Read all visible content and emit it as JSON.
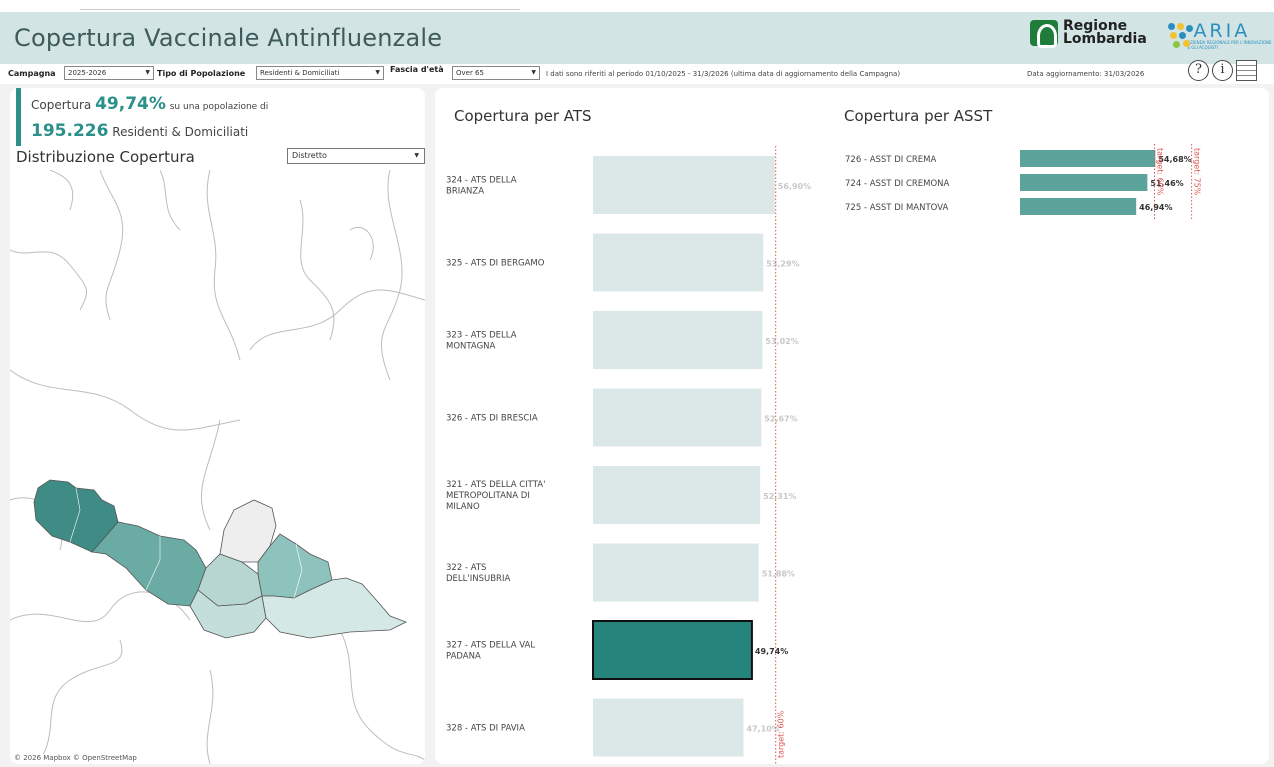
{
  "header": {
    "title": "Copertura Vaccinale Antinfluenzale",
    "logo_rl_line1": "Regione",
    "logo_rl_line2": "Lombardia",
    "logo_aria_name": "ARIA",
    "logo_aria_sub": "AZIENDA REGIONALE PER L'INNOVAZIONE E GLI ACQUISTI"
  },
  "filters": {
    "campagna_label": "Campagna",
    "campagna_value": "2025-2026",
    "popolazione_label": "Tipo di Popolazione",
    "popolazione_value": "Residenti & Domiciliati",
    "eta_label": "Fascia d'età",
    "eta_value": "Over 65",
    "period_note": "I dati sono riferiti al periodo 01/10/2025 - 31/3/2026 (ultima data di aggiornamento della Campagna)",
    "update_note": "Data aggiornamento: 31/03/2026"
  },
  "toolbar": {
    "help_icon": "?",
    "info_icon": "i"
  },
  "kpi": {
    "prefix": "Copertura",
    "value": "49,74%",
    "middle": "su una popolazione di",
    "population": "195.226",
    "suffix": "Residenti & Domiciliati"
  },
  "distribution": {
    "title": "Distribuzione Copertura",
    "select_value": "Distretto",
    "credit": "© 2026 Mapbox © OpenStreetMap"
  },
  "colors": {
    "header_bg": "#d2e5e4",
    "accent": "#2a9089",
    "bar_selected": "#25857d",
    "bar_light": "#dce8e7",
    "bar_asst": "#5ba39b",
    "target": "#d9534f"
  },
  "chart_data": [
    {
      "type": "bar",
      "title": "Copertura per ATS",
      "orientation": "horizontal",
      "categories": [
        "324 - ATS DELLA BRIANZA",
        "325 - ATS DI BERGAMO",
        "323 - ATS DELLA MONTAGNA",
        "326 - ATS DI BRESCIA",
        "321 - ATS DELLA CITTA' METROPOLITANA DI MILANO",
        "322 - ATS DELL'INSUBRIA",
        "327 - ATS DELLA VAL PADANA",
        "328 - ATS DI PAVIA"
      ],
      "values": [
        56.9,
        53.29,
        53.02,
        52.67,
        52.31,
        51.88,
        49.74,
        47.1
      ],
      "labels": [
        "56,90%",
        "53,29%",
        "53,02%",
        "52,67%",
        "52,31%",
        "51,88%",
        "49,74%",
        "47,10%"
      ],
      "selected": "327 - ATS DELLA VAL PADANA",
      "target_value": 60,
      "target_label": "target: 60%"
    },
    {
      "type": "bar",
      "title": "Copertura per ASST",
      "orientation": "horizontal",
      "categories": [
        "726 - ASST DI CREMA",
        "724 - ASST DI CREMONA",
        "725 - ASST DI MANTOVA"
      ],
      "values": [
        54.68,
        51.46,
        46.94
      ],
      "labels": [
        "54,68%",
        "51,46%",
        "46,94%"
      ],
      "targets": [
        {
          "value": 60,
          "label": "target: 60%"
        },
        {
          "value": 75,
          "label": "target: 75%"
        }
      ]
    }
  ]
}
